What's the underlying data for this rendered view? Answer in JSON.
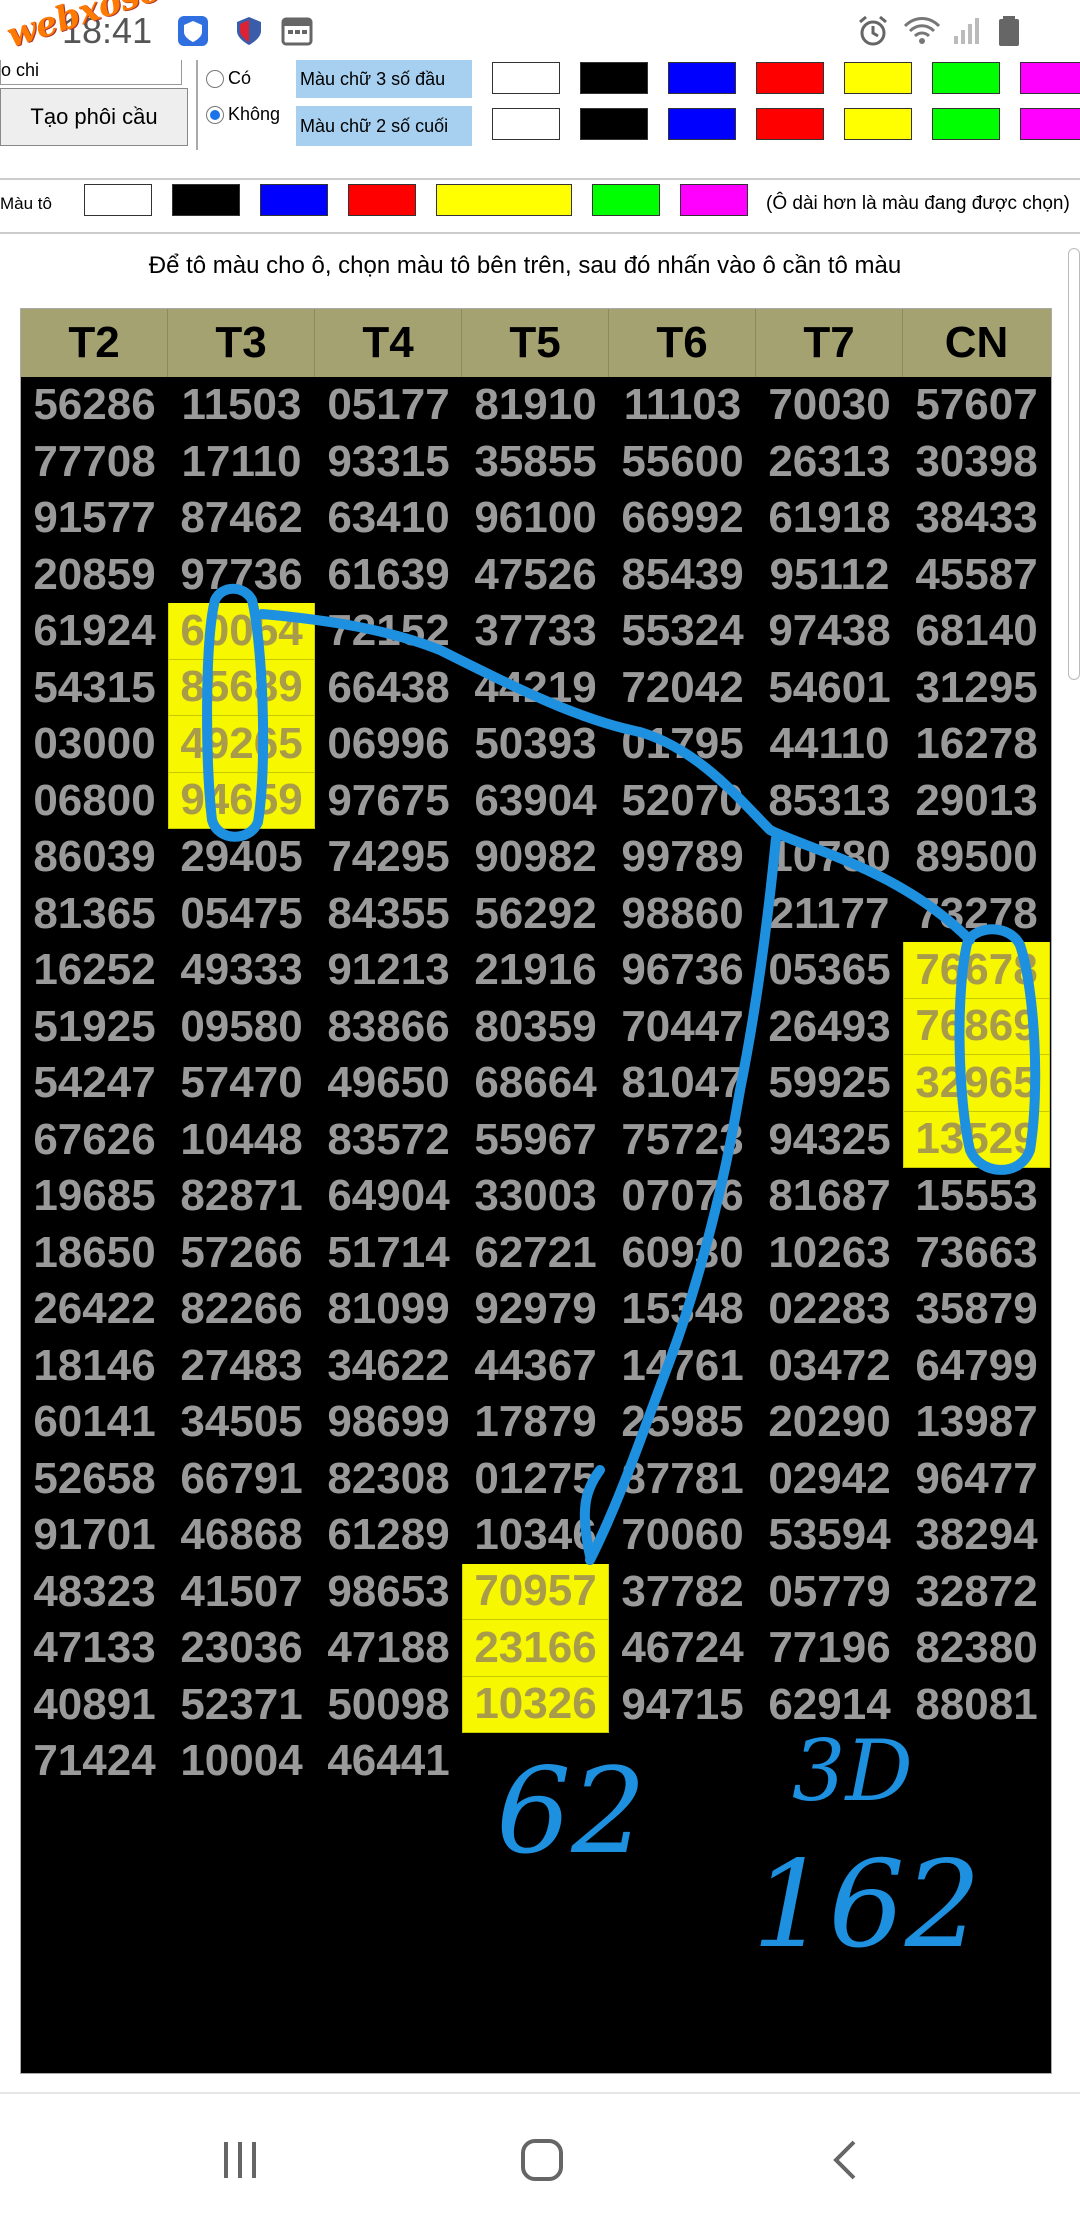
{
  "status_bar": {
    "time": "18:41",
    "watermark": "webxoso.net",
    "icons": [
      "security-shield-icon",
      "calendar-icon",
      "alarm-icon",
      "wifi-icon",
      "signal-icon",
      "battery-icon"
    ]
  },
  "controls": {
    "top_select_value": "o chi",
    "create_button": "Tạo phôi cầu",
    "radio_yes": "Có",
    "radio_no": "Không",
    "radio_selected": "Không",
    "label_first3": "Màu chữ 3 số đầu",
    "label_last2": "Màu chữ 2 số cuối",
    "text_colors": [
      "#ffffff",
      "#000000",
      "#0000ff",
      "#ff0000",
      "#ffff00",
      "#00ff00",
      "#ff00ff"
    ],
    "paint_label": "Màu tô",
    "paint_colors": [
      "#ffffff",
      "#000000",
      "#0000ff",
      "#ff0000",
      "#ffff00",
      "#00ff00",
      "#ff00ff"
    ],
    "paint_selected": "#ffff00",
    "paint_note": "(Ô dài hơn là màu đang được chọn)"
  },
  "instruction": "Để tô màu cho ô, chọn màu tô bên trên, sau đó nhấn vào ô cần tô màu",
  "table": {
    "headers": [
      "T2",
      "T3",
      "T4",
      "T5",
      "T6",
      "T7",
      "CN"
    ],
    "rows": [
      [
        "56286",
        "11503",
        "05177",
        "81910",
        "11103",
        "70030",
        "57607"
      ],
      [
        "77708",
        "17110",
        "93315",
        "35855",
        "55600",
        "26313",
        "30398"
      ],
      [
        "91577",
        "87462",
        "63410",
        "96100",
        "66992",
        "61918",
        "38433"
      ],
      [
        "20859",
        "97736",
        "61639",
        "47526",
        "85439",
        "95112",
        "45587"
      ],
      [
        "61924",
        "60054",
        "72152",
        "37733",
        "55324",
        "97438",
        "68140"
      ],
      [
        "54315",
        "85689",
        "66438",
        "44219",
        "72042",
        "54601",
        "31295"
      ],
      [
        "03000",
        "49265",
        "06996",
        "50393",
        "01795",
        "44110",
        "16278"
      ],
      [
        "06800",
        "94659",
        "97675",
        "63904",
        "52070",
        "85313",
        "29013"
      ],
      [
        "86039",
        "29405",
        "74295",
        "90982",
        "99789",
        "10780",
        "89500"
      ],
      [
        "81365",
        "05475",
        "84355",
        "56292",
        "98860",
        "21177",
        "73278"
      ],
      [
        "16252",
        "49333",
        "91213",
        "21916",
        "96736",
        "05365",
        "76678"
      ],
      [
        "51925",
        "09580",
        "83866",
        "80359",
        "70447",
        "26493",
        "76869"
      ],
      [
        "54247",
        "57470",
        "49650",
        "68664",
        "81047",
        "59925",
        "32965"
      ],
      [
        "67626",
        "10448",
        "83572",
        "55967",
        "75723",
        "94325",
        "13529"
      ],
      [
        "19685",
        "82871",
        "64904",
        "33003",
        "07076",
        "81687",
        "15553"
      ],
      [
        "18650",
        "57266",
        "51714",
        "62721",
        "60930",
        "10263",
        "73663"
      ],
      [
        "26422",
        "82266",
        "81099",
        "92979",
        "15348",
        "02283",
        "35879"
      ],
      [
        "18146",
        "27483",
        "34622",
        "44367",
        "14761",
        "03472",
        "64799"
      ],
      [
        "60141",
        "34505",
        "98699",
        "17879",
        "25985",
        "20290",
        "13987"
      ],
      [
        "52658",
        "66791",
        "82308",
        "01275",
        "87781",
        "02942",
        "96477"
      ],
      [
        "91701",
        "46868",
        "61289",
        "10346",
        "70060",
        "53594",
        "38294"
      ],
      [
        "48323",
        "41507",
        "98653",
        "70957",
        "37782",
        "05779",
        "32872"
      ],
      [
        "47133",
        "23036",
        "47188",
        "23166",
        "46724",
        "77196",
        "82380"
      ],
      [
        "40891",
        "52371",
        "50098",
        "10326",
        "94715",
        "62914",
        "88081"
      ],
      [
        "71424",
        "10004",
        "46441",
        "",
        "",
        "",
        ""
      ]
    ],
    "highlight_color": "#f7f700",
    "highlighted_cells": [
      [
        4,
        1
      ],
      [
        5,
        1
      ],
      [
        6,
        1
      ],
      [
        7,
        1
      ],
      [
        10,
        6
      ],
      [
        11,
        6
      ],
      [
        12,
        6
      ],
      [
        13,
        6
      ],
      [
        21,
        3
      ],
      [
        22,
        3
      ],
      [
        23,
        3
      ]
    ]
  },
  "annotations": {
    "ink_color": "#1e90e0",
    "text_1": "62",
    "text_2": "3D",
    "text_3": "162"
  },
  "nav_bar": {
    "icons": [
      "recent-apps-icon",
      "home-icon",
      "back-icon"
    ]
  }
}
